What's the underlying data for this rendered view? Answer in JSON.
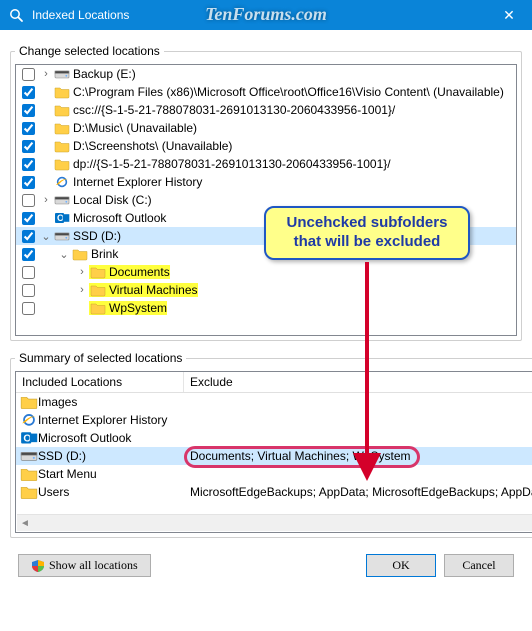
{
  "window": {
    "title": "Indexed Locations",
    "watermark": "TenForums.com",
    "close_glyph": "✕"
  },
  "group_change": {
    "legend": "Change selected locations"
  },
  "tree": [
    {
      "checked": false,
      "expander": ">",
      "indent": 0,
      "icon": "drive",
      "label": "Backup (E:)"
    },
    {
      "checked": true,
      "expander": "",
      "indent": 0,
      "icon": "folder",
      "label": "C:\\Program Files (x86)\\Microsoft Office\\root\\Office16\\Visio Content\\ (Unavailable)"
    },
    {
      "checked": true,
      "expander": "",
      "indent": 0,
      "icon": "folder",
      "label": "csc://{S-1-5-21-788078031-2691013130-2060433956-1001}/"
    },
    {
      "checked": true,
      "expander": "",
      "indent": 0,
      "icon": "folder",
      "label": "D:\\Music\\ (Unavailable)"
    },
    {
      "checked": true,
      "expander": "",
      "indent": 0,
      "icon": "folder",
      "label": "D:\\Screenshots\\ (Unavailable)"
    },
    {
      "checked": true,
      "expander": "",
      "indent": 0,
      "icon": "folder",
      "label": "dp://{S-1-5-21-788078031-2691013130-2060433956-1001}/"
    },
    {
      "checked": true,
      "expander": "",
      "indent": 0,
      "icon": "ie",
      "label": "Internet Explorer History"
    },
    {
      "checked": false,
      "expander": ">",
      "indent": 0,
      "icon": "drive",
      "label": "Local Disk (C:)"
    },
    {
      "checked": true,
      "expander": "",
      "indent": 0,
      "icon": "outlook",
      "label": "Microsoft Outlook"
    },
    {
      "checked": true,
      "expander": "v",
      "indent": 0,
      "icon": "drive",
      "label": "SSD (D:)",
      "selected": true
    },
    {
      "checked": true,
      "expander": "v",
      "indent": 1,
      "icon": "folder",
      "label": "Brink"
    },
    {
      "checked": false,
      "expander": ">",
      "indent": 2,
      "icon": "folder",
      "label": "Documents",
      "hl": true
    },
    {
      "checked": false,
      "expander": ">",
      "indent": 2,
      "icon": "folder",
      "label": "Virtual Machines",
      "hl": true
    },
    {
      "checked": false,
      "expander": "",
      "indent": 2,
      "icon": "folder",
      "label": "WpSystem",
      "hl": true
    }
  ],
  "group_summary": {
    "legend": "Summary of selected locations"
  },
  "summary": {
    "headers": {
      "included": "Included Locations",
      "exclude": "Exclude"
    },
    "rows": [
      {
        "icon": "folder",
        "name": "Images",
        "exclude": ""
      },
      {
        "icon": "ie",
        "name": "Internet Explorer History",
        "exclude": ""
      },
      {
        "icon": "outlook",
        "name": "Microsoft Outlook",
        "exclude": ""
      },
      {
        "icon": "drive",
        "name": "SSD (D:)",
        "exclude": "Documents; Virtual Machines; WpSystem",
        "selected": true,
        "circle": true
      },
      {
        "icon": "folder",
        "name": "Start Menu",
        "exclude": ""
      },
      {
        "icon": "folder",
        "name": "Users",
        "exclude": "MicrosoftEdgeBackups; AppData; MicrosoftEdgeBackups; AppData"
      }
    ]
  },
  "callout": {
    "text": "Uncehcked subfolders that will be excluded"
  },
  "footer": {
    "show_all": "Show all locations",
    "ok": "OK",
    "cancel": "Cancel"
  },
  "colors": {
    "accent": "#0a84d8",
    "highlight": "#ffff3d",
    "selection": "#cde8ff",
    "callout_border": "#1f57c3",
    "circle": "#d8356a"
  }
}
